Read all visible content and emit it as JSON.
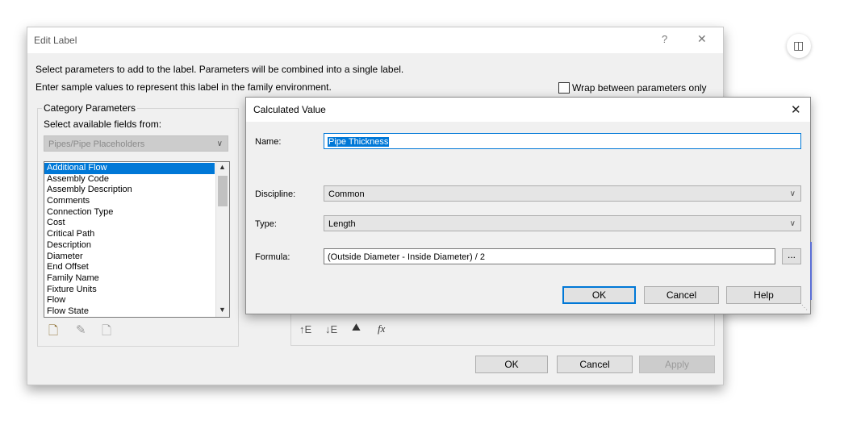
{
  "edit_label": {
    "title": "Edit Label",
    "help_glyph": "?",
    "close_glyph": "✕",
    "instructions_1": "Select parameters to add to the label.  Parameters will be combined into a single label.",
    "instructions_2": "Enter sample values to represent this label in the family environment.",
    "wrap_checkbox_label": "Wrap between parameters only",
    "category_group_title": "Category Parameters",
    "select_fields_label": "Select available fields from:",
    "category_combo_value": "Pipes/Pipe Placeholders",
    "parameters": [
      "Additional Flow",
      "Assembly Code",
      "Assembly Description",
      "Comments",
      "Connection Type",
      "Cost",
      "Critical Path",
      "Description",
      "Diameter",
      "End Offset",
      "Family Name",
      "Fixture Units",
      "Flow",
      "Flow State"
    ],
    "selected_parameter": "Additional Flow",
    "ok_label": "OK",
    "cancel_label": "Cancel",
    "apply_label": "Apply",
    "icons": [
      "new-parameter-icon",
      "edit-parameter-icon",
      "delete-parameter-icon",
      "move-up-icon",
      "move-down-icon",
      "format-icon",
      "calculated-value-icon"
    ]
  },
  "calculated_value": {
    "title": "Calculated Value",
    "close_glyph": "✕",
    "name_label": "Name:",
    "name_value": "Pipe Thickness",
    "discipline_label": "Discipline:",
    "discipline_value": "Common",
    "type_label": "Type:",
    "type_value": "Length",
    "formula_label": "Formula:",
    "formula_value": "(Outside Diameter - Inside Diameter) / 2",
    "browse_label": "...",
    "ok_label": "OK",
    "cancel_label": "Cancel",
    "help_label": "Help"
  },
  "colors": {
    "accent": "#0078d7",
    "dialog_bg": "#f0f0f0",
    "disabled": "#cccccc"
  }
}
